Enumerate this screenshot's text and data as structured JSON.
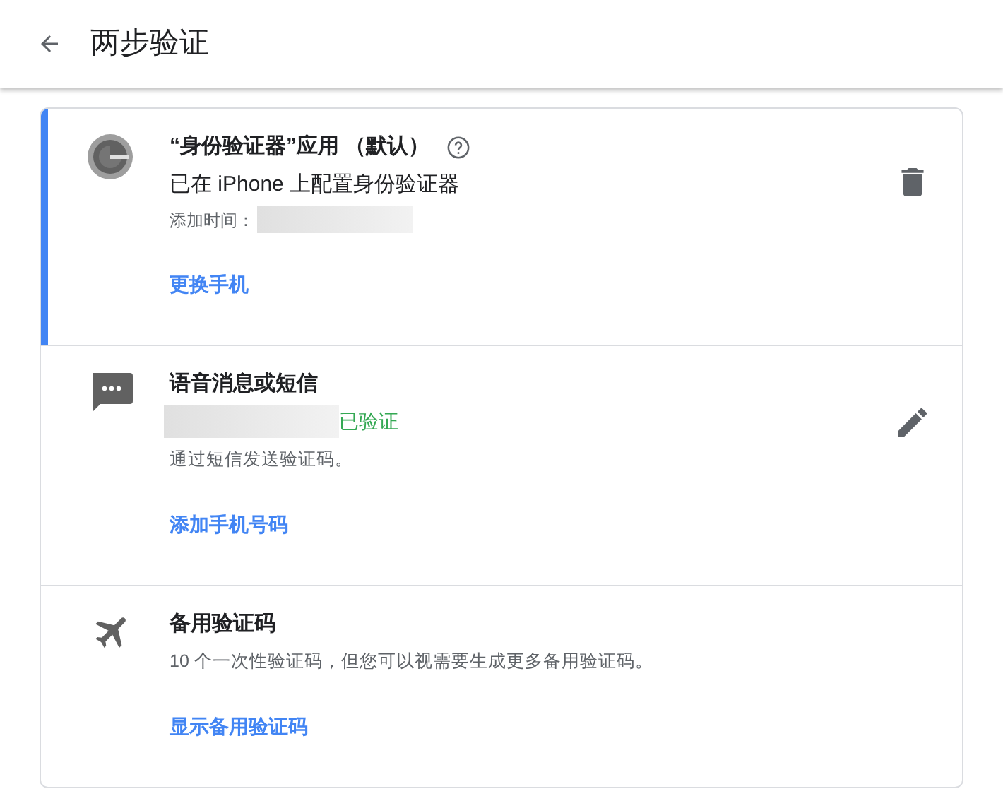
{
  "header": {
    "title": "两步验证"
  },
  "sections": [
    {
      "kind": "authenticator",
      "selected": true,
      "title": "“身份验证器”应用 （默认）",
      "subtitle": "已在 iPhone 上配置身份验证器",
      "meta_label": "添加时间：",
      "link": "更换手机"
    },
    {
      "kind": "sms",
      "selected": false,
      "title": "语音消息或短信",
      "status": "已验证",
      "description": "通过短信发送验证码。",
      "link": "添加手机号码"
    },
    {
      "kind": "backup",
      "selected": false,
      "title": "备用验证码",
      "description": "10 个一次性验证码，但您可以视需要生成更多备用验证码。",
      "link": "显示备用验证码"
    }
  ]
}
